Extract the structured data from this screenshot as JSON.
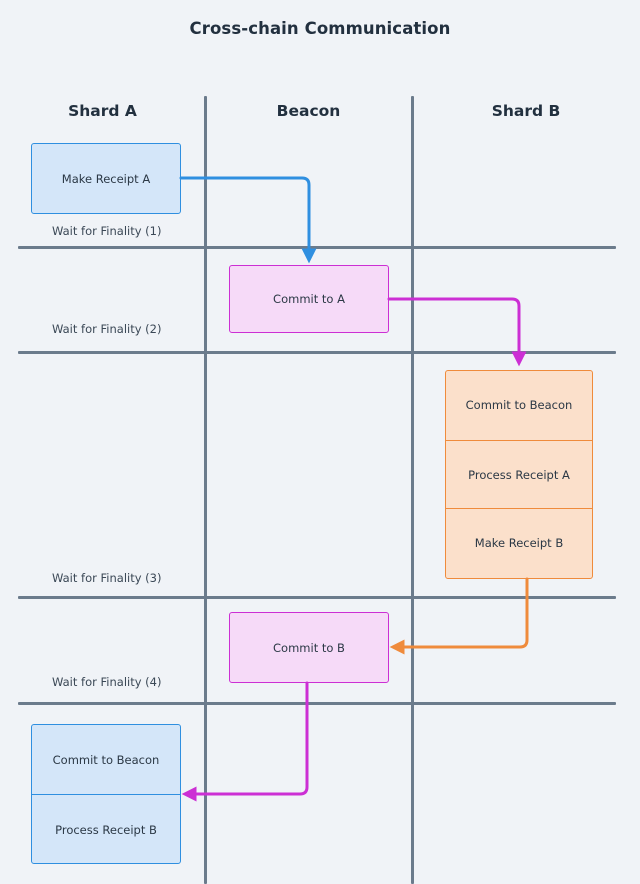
{
  "diagram": {
    "title": "Cross-chain Communication",
    "columns": [
      {
        "id": "shard-a",
        "label": "Shard A"
      },
      {
        "id": "beacon",
        "label": "Beacon"
      },
      {
        "id": "shard-b",
        "label": "Shard B"
      }
    ],
    "finality_rules": [
      {
        "label": "Wait for Finality (1)"
      },
      {
        "label": "Wait for Finality (2)"
      },
      {
        "label": "Wait for Finality (3)"
      },
      {
        "label": "Wait for Finality (4)"
      }
    ],
    "nodes": {
      "make_receipt_a": "Make Receipt A",
      "commit_to_a": "Commit to A",
      "commit_to_b": "Commit to B",
      "shard_b_stack": [
        "Commit to Beacon",
        "Process Receipt A",
        "Make Receipt B"
      ],
      "shard_a_bottom_stack": [
        "Commit to Beacon",
        "Process Receipt B"
      ]
    },
    "colors": {
      "background": "#f0f3f7",
      "text": "#22303f",
      "rule": "#6b7b8c",
      "blue_fill": "#d4e6f9",
      "blue_stroke": "#2f8fe0",
      "pink_fill": "#f6daf8",
      "pink_stroke": "#cc2fd4",
      "orange_fill": "#fbe0cb",
      "orange_stroke": "#ef8b3c"
    },
    "edges": [
      {
        "id": "receipt-a-to-commit-a",
        "from": "Make Receipt A",
        "to": "Commit to A",
        "color": "#2f8fe0"
      },
      {
        "id": "commit-a-to-shard-b",
        "from": "Commit to A",
        "to": "Commit to Beacon",
        "color": "#cc2fd4"
      },
      {
        "id": "shard-b-to-commit-b",
        "from": "Make Receipt B",
        "to": "Commit to B",
        "color": "#ef8b3c"
      },
      {
        "id": "commit-b-to-shard-a",
        "from": "Commit to B",
        "to": "Process Receipt B",
        "color": "#cc2fd4"
      }
    ]
  }
}
